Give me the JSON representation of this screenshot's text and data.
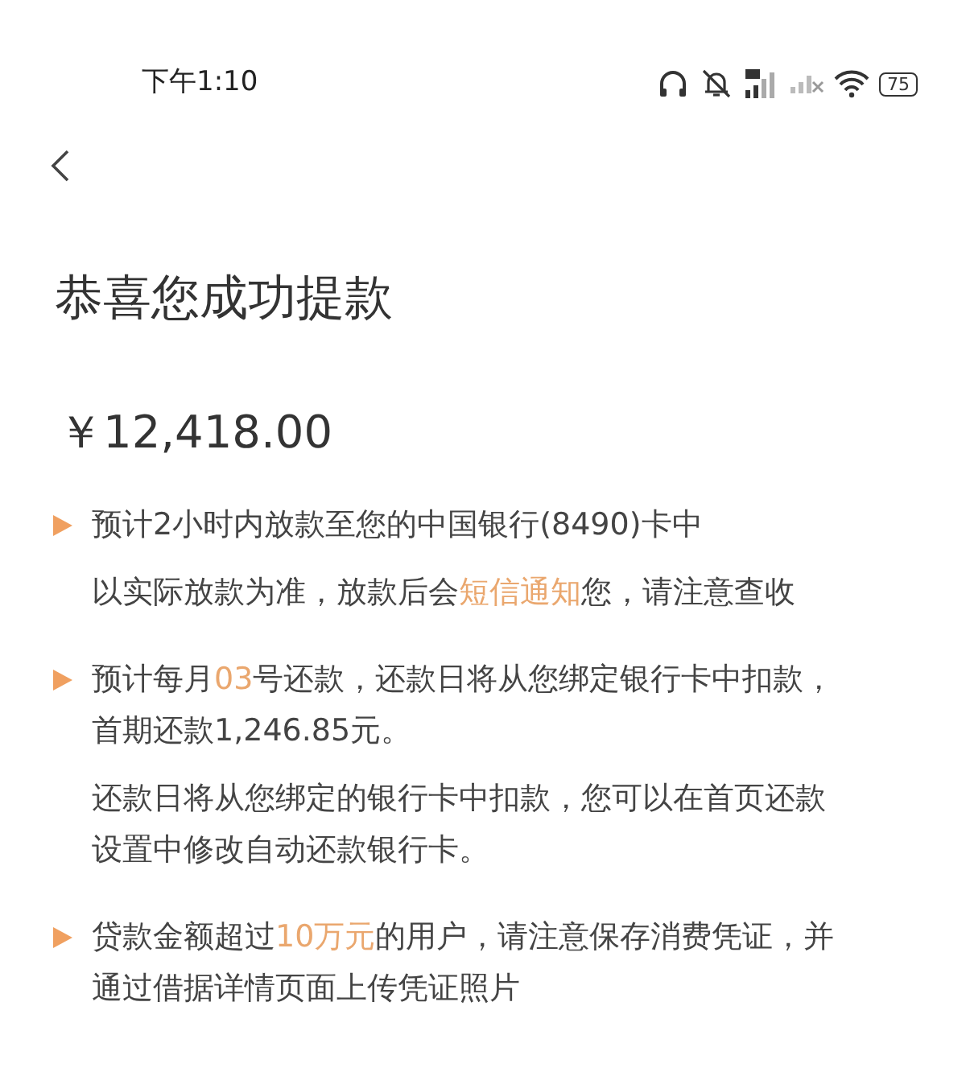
{
  "status_bar": {
    "time": "下午1:10",
    "battery": "75"
  },
  "title": "恭喜您成功提款",
  "amount": "￥12,418.00",
  "items": [
    {
      "kind": "bullet",
      "segments": [
        {
          "text": "预计2小时内放款至您的中国银行(8490)卡中",
          "highlight": false
        }
      ]
    },
    {
      "kind": "note",
      "segments": [
        {
          "text": "以实际放款为准，放款后会",
          "highlight": false
        },
        {
          "text": "短信通知",
          "highlight": true
        },
        {
          "text": "您，请注意查收",
          "highlight": false
        }
      ]
    },
    {
      "kind": "bullet",
      "segments": [
        {
          "text": "预计每月",
          "highlight": false
        },
        {
          "text": "03",
          "highlight": true
        },
        {
          "text": "号还款，还款日将从您绑定银行卡中扣款，首期还款1,246.85元。",
          "highlight": false
        }
      ]
    },
    {
      "kind": "note",
      "segments": [
        {
          "text": "还款日将从您绑定的银行卡中扣款，您可以在首页还款设置中修改自动还款银行卡。",
          "highlight": false
        }
      ]
    },
    {
      "kind": "bullet",
      "segments": [
        {
          "text": "贷款金额超过",
          "highlight": false
        },
        {
          "text": "10万元",
          "highlight": true
        },
        {
          "text": "的用户，请注意保存消费凭证，并通过借据详情页面上传凭证照片",
          "highlight": false
        }
      ]
    }
  ]
}
